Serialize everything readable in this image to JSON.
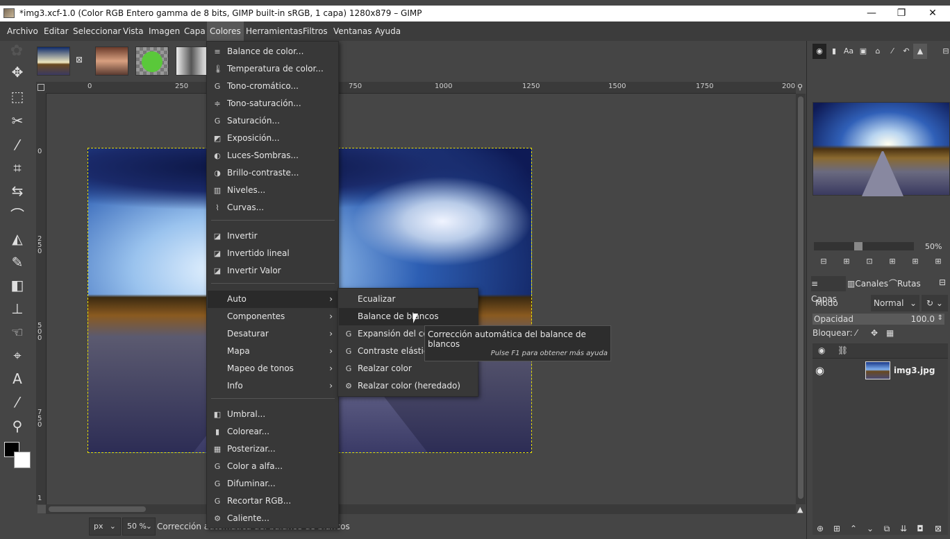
{
  "window": {
    "title": "*img3.xcf-1.0 (Color RGB Entero gamma de 8 bits, GIMP built-in sRGB, 1 capa) 1280x879 – GIMP",
    "minimize": "—",
    "maximize": "❐",
    "close": "✕"
  },
  "menubar": [
    {
      "label": "Archivo"
    },
    {
      "label": "Editar"
    },
    {
      "label": "Seleccionar"
    },
    {
      "label": "Vista"
    },
    {
      "label": "Imagen"
    },
    {
      "label": "Capa"
    },
    {
      "label": "Colores"
    },
    {
      "label": "Herramientas"
    },
    {
      "label": "Filtros"
    },
    {
      "label": "Ventanas"
    },
    {
      "label": "Ayuda"
    }
  ],
  "ruler": {
    "h_ticks": [
      "0",
      "250",
      "750",
      "1000",
      "1250",
      "1500",
      "1750",
      "200"
    ],
    "v_ticks": [
      "0",
      "2\n5\n0",
      "5\n0\n0",
      "7\n5\n0",
      "1"
    ]
  },
  "colores_menu": [
    {
      "label": "Balance de color...",
      "icon": "balance-icon"
    },
    {
      "label": "Temperatura de color...",
      "icon": "thermometer-icon"
    },
    {
      "label": "Tono-cromático...",
      "icon": "gegl-icon"
    },
    {
      "label": "Tono-saturación...",
      "icon": "hue-sat-icon"
    },
    {
      "label": "Saturación...",
      "icon": "gegl-icon"
    },
    {
      "label": "Exposición...",
      "icon": "exposure-icon"
    },
    {
      "label": "Luces-Sombras...",
      "icon": "shadows-icon"
    },
    {
      "label": "Brillo-contraste...",
      "icon": "brightness-icon"
    },
    {
      "label": "Niveles...",
      "icon": "levels-icon"
    },
    {
      "label": "Curvas...",
      "icon": "curves-icon"
    },
    {
      "label": "Invertir",
      "icon": "invert-icon"
    },
    {
      "label": "Invertido lineal",
      "icon": "invert-icon"
    },
    {
      "label": "Invertir Valor",
      "icon": "invert-icon"
    },
    {
      "label": "Auto",
      "arrow": "›"
    },
    {
      "label": "Componentes",
      "arrow": "›"
    },
    {
      "label": "Desaturar",
      "arrow": "›"
    },
    {
      "label": "Mapa",
      "arrow": "›"
    },
    {
      "label": "Mapeo de tonos",
      "arrow": "›"
    },
    {
      "label": "Info",
      "arrow": "›"
    },
    {
      "label": "Umbral...",
      "icon": "threshold-icon"
    },
    {
      "label": "Colorear...",
      "icon": "colorize-icon"
    },
    {
      "label": "Posterizar...",
      "icon": "posterize-icon"
    },
    {
      "label": "Color a alfa...",
      "icon": "gegl-icon"
    },
    {
      "label": "Difuminar...",
      "icon": "gegl-icon"
    },
    {
      "label": "Recortar RGB...",
      "icon": "gegl-icon"
    },
    {
      "label": "Caliente...",
      "icon": "plugin-icon"
    }
  ],
  "auto_menu": [
    {
      "label": "Ecualizar"
    },
    {
      "label": "Balance de blancos"
    },
    {
      "label": "Expansión del contraste"
    },
    {
      "label": "Contraste elástico"
    },
    {
      "label": "Realzar color"
    },
    {
      "label": "Realzar color  (heredado)"
    }
  ],
  "tooltip": {
    "main": "Corrección automática del balance de blancos",
    "hint": "Pulse F1 para obtener más ayuda"
  },
  "statusbar": {
    "unit": "px",
    "zoom": "50 %",
    "message": "Corrección automática del balance de blancos"
  },
  "navigator": {
    "zoom": "50%"
  },
  "layers_panel": {
    "tabs": [
      "Capas",
      "Canales",
      "Rutas"
    ],
    "mode_label": "Modo",
    "mode_value": "Normal",
    "opacity_label": "Opacidad",
    "opacity_value": "100.0",
    "lock_label": "Bloquear:",
    "layer_name": "img3.jpg"
  }
}
